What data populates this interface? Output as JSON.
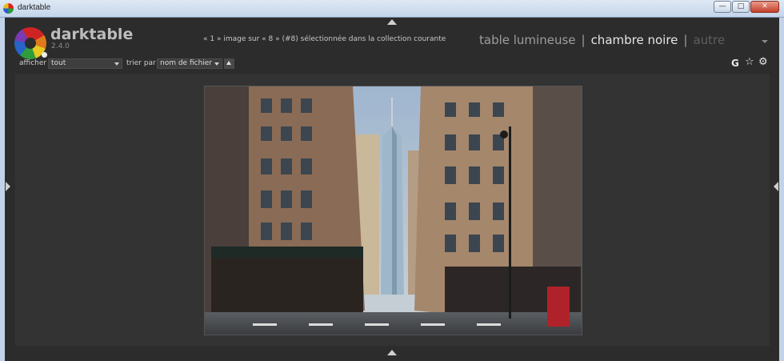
{
  "window": {
    "title": "darktable",
    "min_label": "—",
    "max_label": "□",
    "close_label": "✕"
  },
  "header": {
    "app_name": "darktable",
    "version": "2.4.0",
    "status": "« 1 » image sur « 8 » (#8) sélectionnée dans la collection courante"
  },
  "views": {
    "lighttable": "table lumineuse",
    "separator": "|",
    "darkroom": "chambre noire",
    "other": "autre",
    "active": "darkroom"
  },
  "filter": {
    "show_label": "afficher",
    "show_value": "tout",
    "sort_label": "trier par",
    "sort_value": "nom de fichier"
  },
  "toolbar": {
    "grouping_label": "G",
    "star_glyph": "☆",
    "gear_glyph": "⚙"
  },
  "icons": [
    "app-icon",
    "darktable-logo",
    "triangle-up-icon",
    "triangle-left-icon",
    "triangle-right-icon",
    "star-icon",
    "gear-icon",
    "chevron-down-icon"
  ],
  "colors": {
    "background": "#2c2c2c",
    "center": "#333333",
    "active_view": "#e6e6e6",
    "inactive_view": "#9e9e9e",
    "dim_view": "#5f5f5f"
  }
}
